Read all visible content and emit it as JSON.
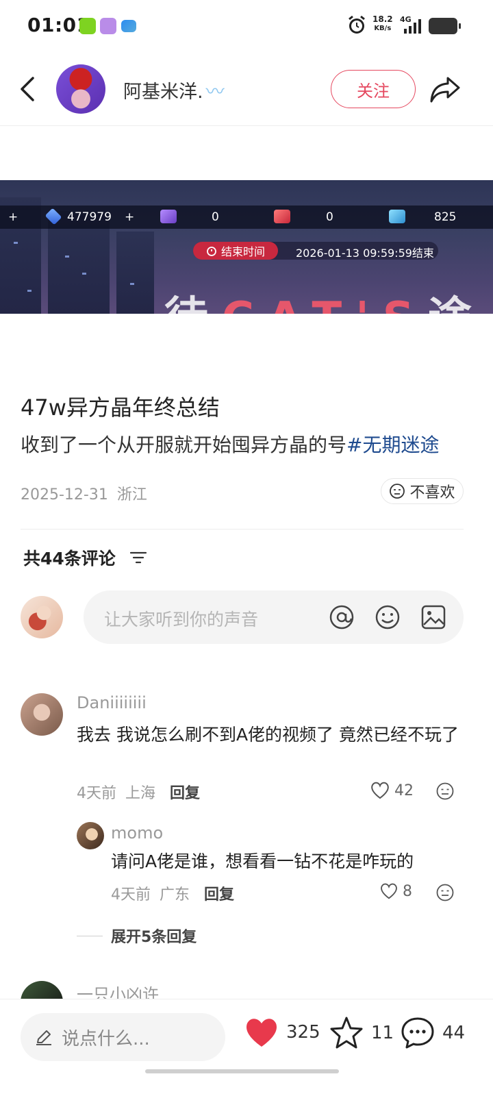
{
  "status_bar": {
    "time": "01:01",
    "net_speed_value": "18.2",
    "net_speed_unit": "KB/s",
    "network": "4G"
  },
  "header": {
    "author_name": "阿基米洋.",
    "follow_label": "关注"
  },
  "banner": {
    "resources": [
      "477979",
      "0",
      "0",
      "825"
    ],
    "end_time_label": "结束时间",
    "end_time_value": "2026-01-13 09:59:59结束",
    "deco_text": "CAT'S"
  },
  "post": {
    "title": "47w异方晶年终总结",
    "body": "收到了一个从开服就开始囤异方晶的号",
    "topic": "#无期迷途",
    "date": "2025-12-31",
    "location": "浙江",
    "dislike_label": "不喜欢"
  },
  "comments_header": {
    "count_label": "共44条评论"
  },
  "comment_input": {
    "placeholder": "让大家听到你的声音"
  },
  "comments": [
    {
      "name": "Daniiiiiiii",
      "text": "我去 我说怎么刷不到A佬的视频了 竟然已经不玩了",
      "time": "4天前",
      "location": "上海",
      "reply_label": "回复",
      "likes": "42"
    },
    {
      "name": "momo",
      "text": "请问A佬是谁，想看看一钻不花是咋玩的",
      "time": "4天前",
      "location": "广东",
      "reply_label": "回复",
      "likes": "8"
    },
    {
      "name": "一只小凶许"
    }
  ],
  "expand_replies": "展开5条回复",
  "bottom_bar": {
    "input_placeholder": "说点什么...",
    "likes": "325",
    "stars": "11",
    "comments": "44"
  },
  "colors": {
    "accent_red": "#e5485f",
    "topic_blue": "#1f4b8f",
    "heart_red": "#e8394c"
  }
}
